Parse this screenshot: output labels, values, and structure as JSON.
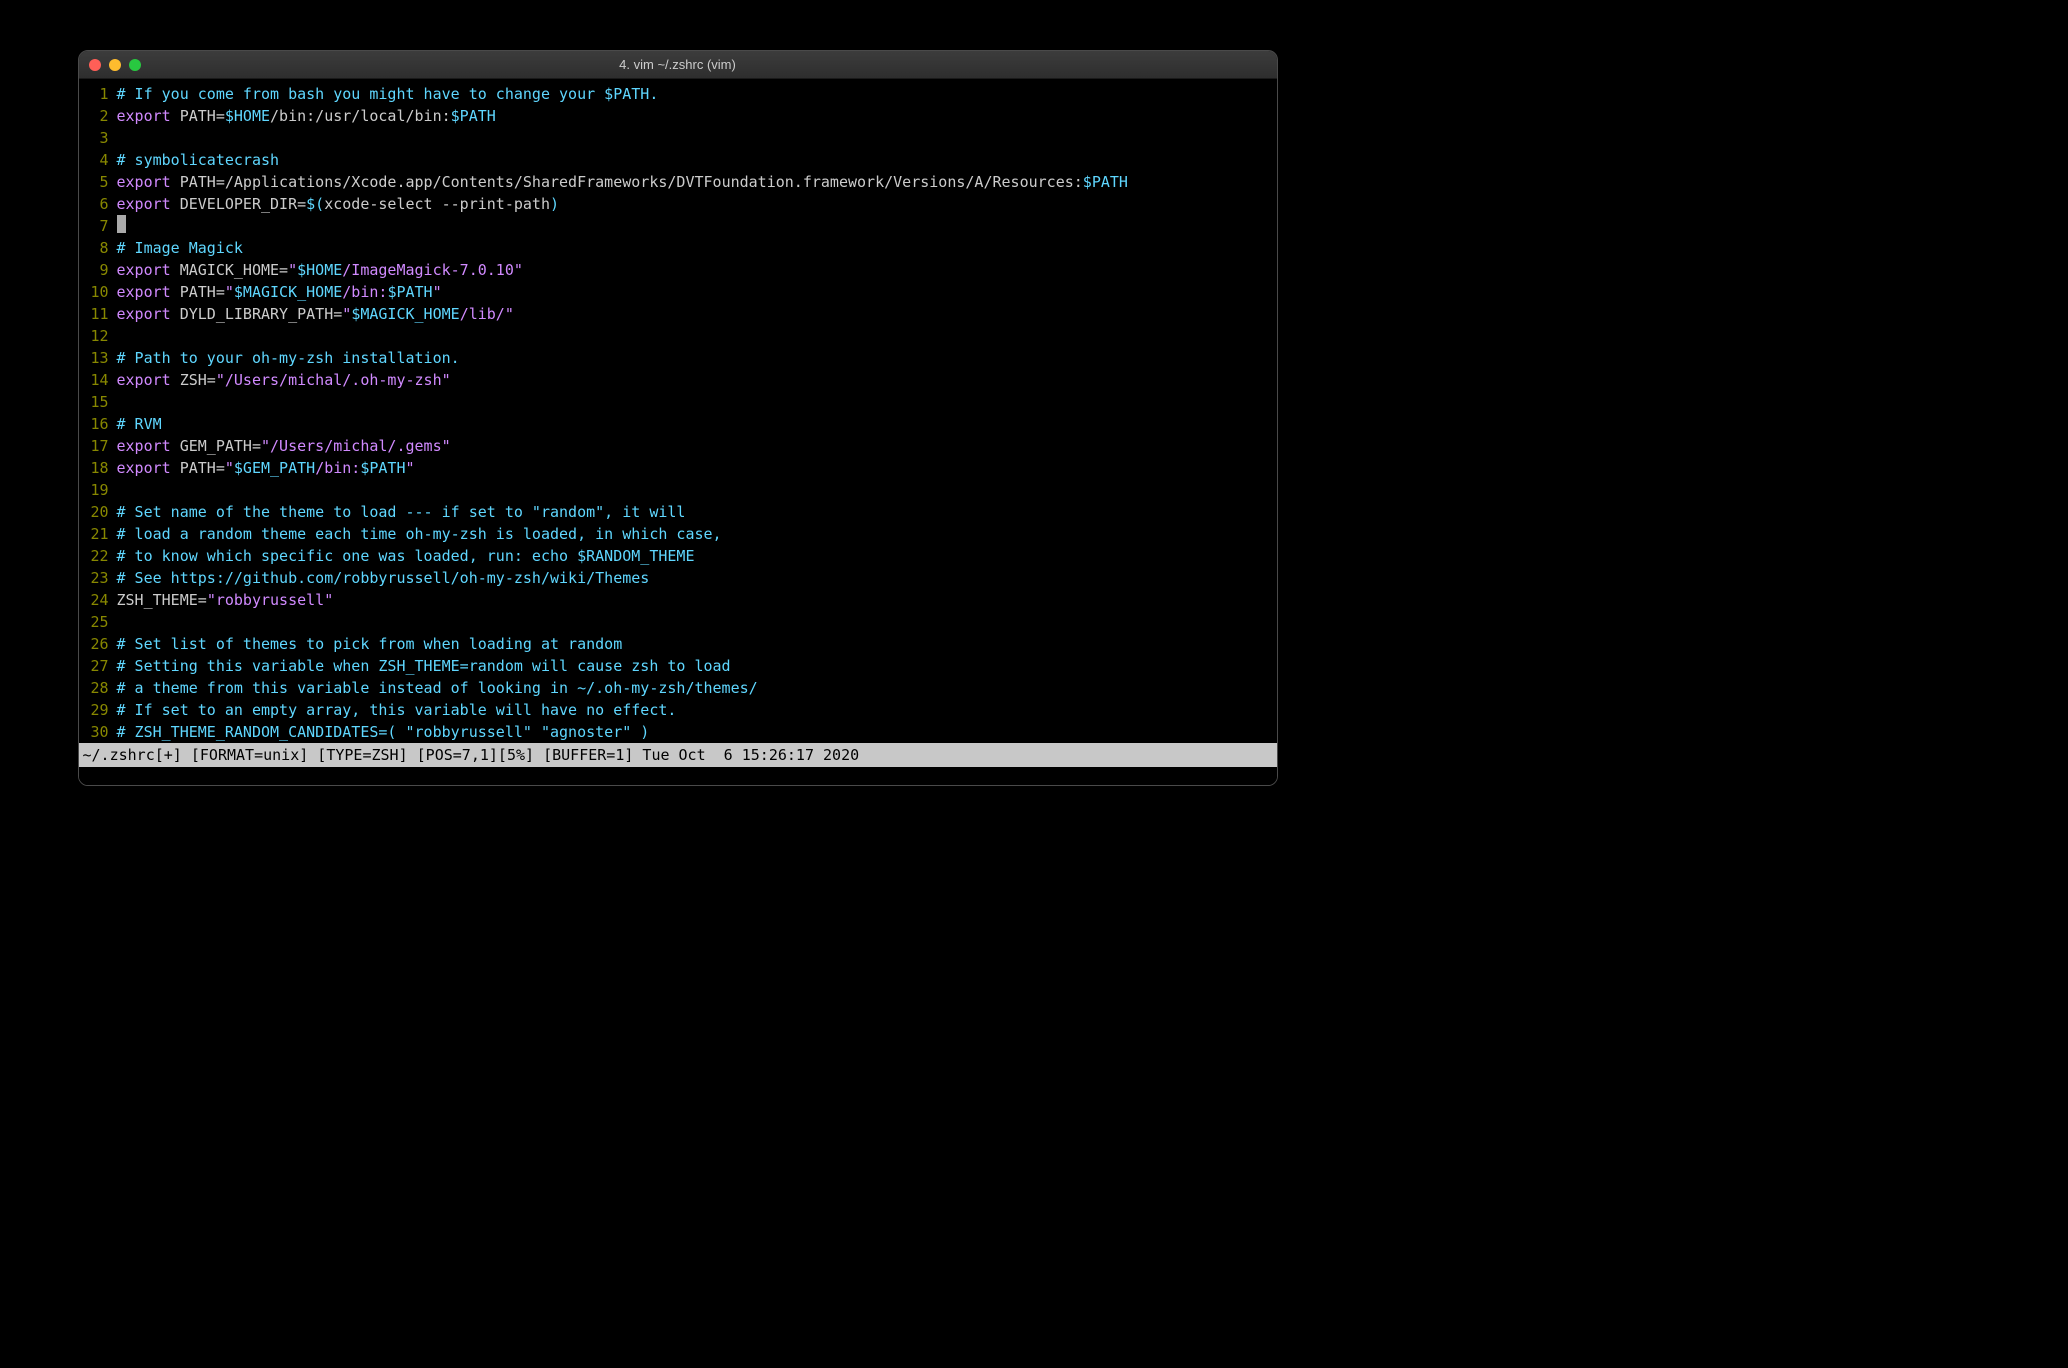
{
  "title": "4. vim ~/.zshrc (vim)",
  "statusbar": "~/.zshrc[+] [FORMAT=unix] [TYPE=ZSH] [POS=7,1][5%] [BUFFER=1] Tue Oct  6 15:26:17 2020",
  "lines": {
    "n1": "1",
    "n2": "2",
    "n3": "3",
    "n4": "4",
    "n5": "5",
    "n6": "6",
    "n7": "7",
    "n8": "8",
    "n9": "9",
    "n10": "10",
    "n11": "11",
    "n12": "12",
    "n13": "13",
    "n14": "14",
    "n15": "15",
    "n16": "16",
    "n17": "17",
    "n18": "18",
    "n19": "19",
    "n20": "20",
    "n21": "21",
    "n22": "22",
    "n23": "23",
    "n24": "24",
    "n25": "25",
    "n26": "26",
    "n27": "27",
    "n28": "28",
    "n29": "29",
    "n30": "30"
  },
  "c1": "# If you come from bash you might have to change your $PATH.",
  "l2": {
    "a": "export",
    "b": " PATH=",
    "c": "$HOME",
    "d": "/bin:/usr/local/bin:",
    "e": "$PATH"
  },
  "c4": "# symbolicatecrash",
  "l5": {
    "a": "export",
    "b": " PATH=/Applications/Xcode.app/Contents/SharedFrameworks/DVTFoundation.framework/Versions/A/Resources:",
    "c": "$PATH"
  },
  "l6": {
    "a": "export",
    "b": " DEVELOPER_DIR=",
    "c": "$(",
    "d": "xcode-select --print-path",
    "e": ")"
  },
  "c8": "# Image Magick",
  "l9": {
    "a": "export",
    "b": " MAGICK_HOME=",
    "c": "\"",
    "d": "$HOME",
    "e": "/ImageMagick-7.0.10",
    "f": "\""
  },
  "l10": {
    "a": "export",
    "b": " PATH=",
    "c": "\"",
    "d": "$MAGICK_HOME",
    "e": "/bin:",
    "f": "$PATH",
    "g": "\""
  },
  "l11": {
    "a": "export",
    "b": " DYLD_LIBRARY_PATH=",
    "c": "\"",
    "d": "$MAGICK_HOME",
    "e": "/lib/",
    "f": "\""
  },
  "c13": "# Path to your oh-my-zsh installation.",
  "l14": {
    "a": "export",
    "b": " ZSH=",
    "c": "\"/Users/michal/.oh-my-zsh\""
  },
  "c16": "# RVM",
  "l17": {
    "a": "export",
    "b": " GEM_PATH=",
    "c": "\"/Users/michal/.gems\""
  },
  "l18": {
    "a": "export",
    "b": " PATH=",
    "c": "\"",
    "d": "$GEM_PATH",
    "e": "/bin:",
    "f": "$PATH",
    "g": "\""
  },
  "c20": "# Set name of the theme to load --- if set to \"random\", it will",
  "c21": "# load a random theme each time oh-my-zsh is loaded, in which case,",
  "c22": "# to know which specific one was loaded, run: echo $RANDOM_THEME",
  "c23": "# See https://github.com/robbyrussell/oh-my-zsh/wiki/Themes",
  "l24": {
    "a": "ZSH_THEME=",
    "b": "\"robbyrussell\""
  },
  "c26": "# Set list of themes to pick from when loading at random",
  "c27": "# Setting this variable when ZSH_THEME=random will cause zsh to load",
  "c28": "# a theme from this variable instead of looking in ~/.oh-my-zsh/themes/",
  "c29": "# If set to an empty array, this variable will have no effect.",
  "c30": "# ZSH_THEME_RANDOM_CANDIDATES=( \"robbyrussell\" \"agnoster\" )"
}
